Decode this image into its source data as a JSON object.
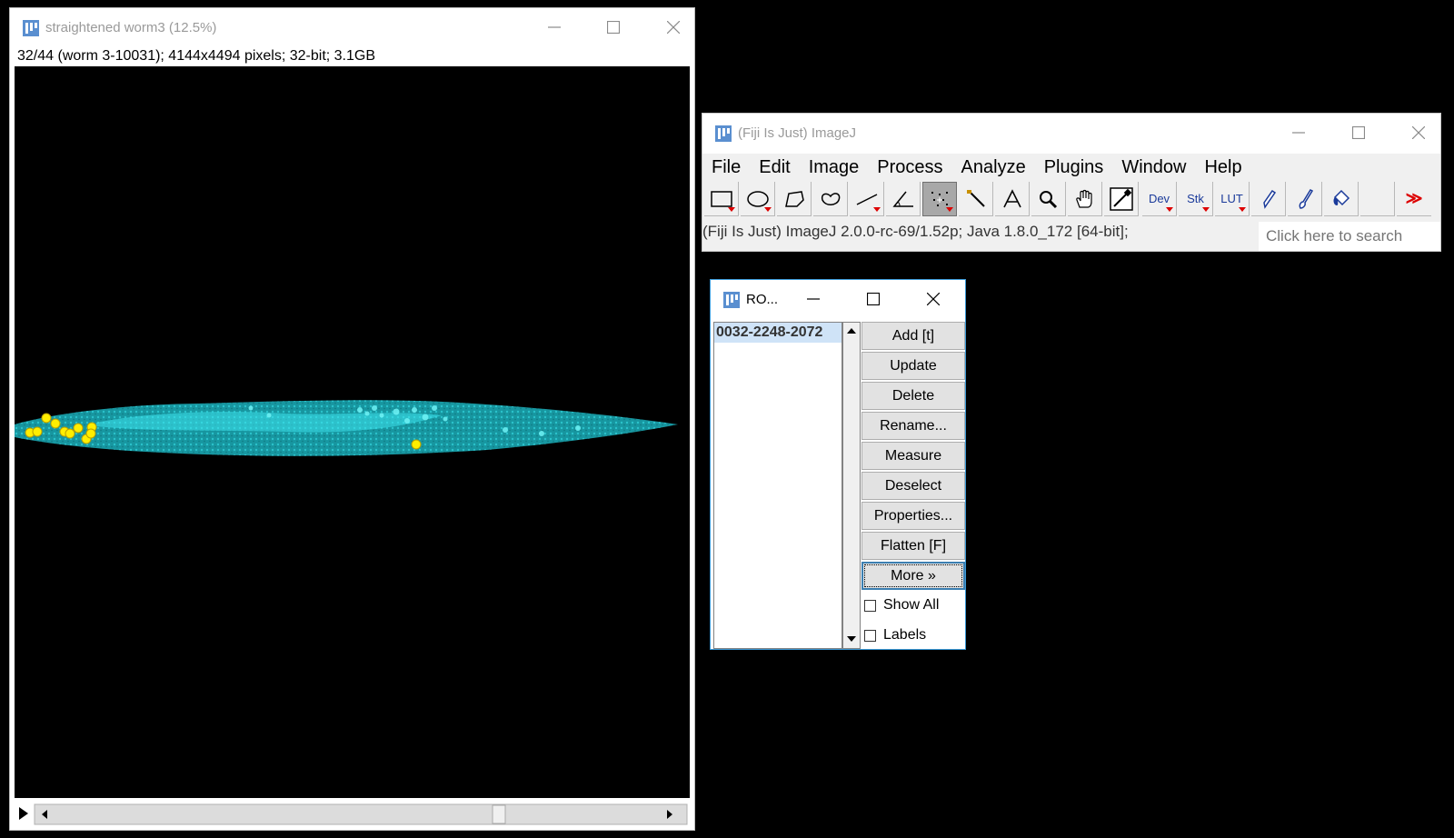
{
  "image_window": {
    "title": "straightened worm3 (12.5%)",
    "info": "32/44 (worm 3-10031); 4144x4494 pixels; 32-bit; 3.1GB",
    "icons": {
      "app": "fiji-icon",
      "minimize": "minimize-icon",
      "maximize": "maximize-icon",
      "close": "close-icon"
    },
    "colors": {
      "cell_signal": "#19c8d2",
      "roi_marker": "#ffee00"
    }
  },
  "imagej_window": {
    "title": "(Fiji Is Just) ImageJ",
    "menus": [
      "File",
      "Edit",
      "Image",
      "Process",
      "Analyze",
      "Plugins",
      "Window",
      "Help"
    ],
    "tools": [
      {
        "name": "rectangle-tool",
        "icon": "rectangle-icon"
      },
      {
        "name": "oval-tool",
        "icon": "oval-icon"
      },
      {
        "name": "polygon-tool",
        "icon": "polygon-icon"
      },
      {
        "name": "freehand-tool",
        "icon": "freehand-icon"
      },
      {
        "name": "line-tool",
        "icon": "line-icon"
      },
      {
        "name": "angle-tool",
        "icon": "angle-icon"
      },
      {
        "name": "multipoint-tool",
        "icon": "multipoint-icon",
        "selected": true
      },
      {
        "name": "wand-tool",
        "icon": "wand-icon"
      },
      {
        "name": "text-tool",
        "icon": "text-icon"
      },
      {
        "name": "zoom-tool",
        "icon": "magnifier-icon"
      },
      {
        "name": "hand-tool",
        "icon": "hand-icon"
      },
      {
        "name": "color-picker-tool",
        "icon": "eyedropper-icon"
      },
      {
        "name": "dev-menu",
        "label": "Dev"
      },
      {
        "name": "stk-menu",
        "label": "Stk"
      },
      {
        "name": "lut-menu",
        "label": "LUT"
      },
      {
        "name": "pencil-tool",
        "icon": "pencil-icon"
      },
      {
        "name": "brush-tool",
        "icon": "brush-icon"
      },
      {
        "name": "flood-fill-tool",
        "icon": "bucket-icon"
      },
      {
        "name": "more-tools",
        "label": "≫"
      }
    ],
    "status": "(Fiji Is Just) ImageJ 2.0.0-rc-69/1.52p; Java 1.8.0_172 [64-bit];",
    "search_placeholder": "Click here to search"
  },
  "roi_manager": {
    "title": "RO...",
    "items": [
      "0032-2248-2072"
    ],
    "buttons": {
      "add": "Add [t]",
      "update": "Update",
      "delete": "Delete",
      "rename": "Rename...",
      "measure": "Measure",
      "deselect": "Deselect",
      "properties": "Properties...",
      "flatten": "Flatten [F]",
      "more": "More »"
    },
    "checkboxes": {
      "show_all": "Show All",
      "labels": "Labels"
    }
  }
}
